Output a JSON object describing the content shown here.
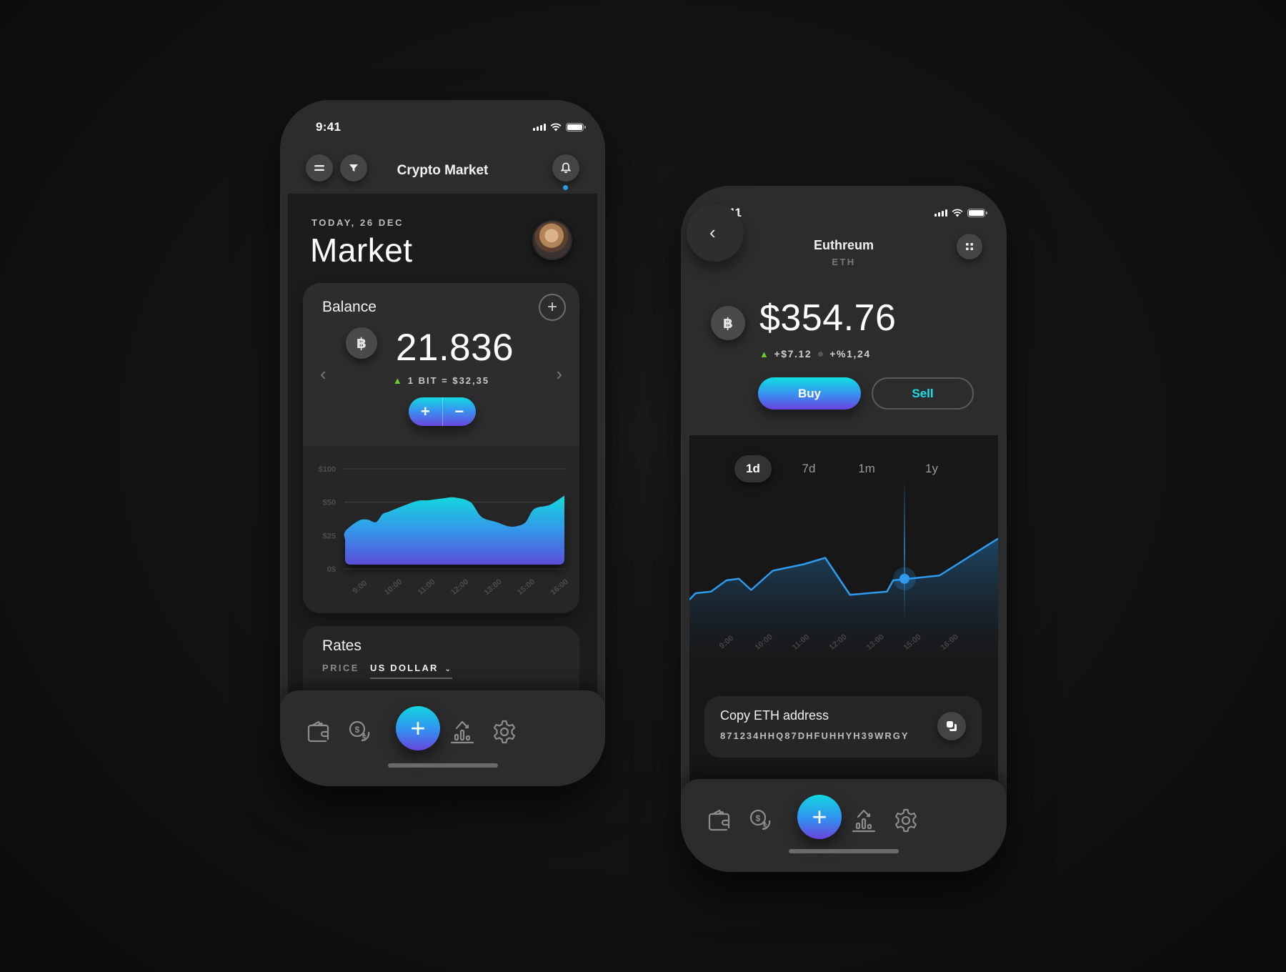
{
  "left_phone": {
    "status": {
      "time": "9:41"
    },
    "header": {
      "title": "Crypto Market",
      "menu_icon": "menu-icon",
      "filter_icon": "filter-icon",
      "notification_icon": "bell-icon",
      "notification_dot": true
    },
    "date_label": "TODAY, 26 DEC",
    "page_title": "Market",
    "balance": {
      "title": "Balance",
      "add_icon": "plus-circle-icon",
      "coin_icon": "bitcoin-icon",
      "coin_glyph": "฿",
      "amount": "21.836",
      "rate": "1 BIT = $32,35",
      "trend": "up",
      "increment_label": "+",
      "decrement_label": "−",
      "prev_arrow": "‹",
      "next_arrow": "›"
    },
    "rates": {
      "title": "Rates",
      "price_label": "PRICE",
      "currency": "US DOLLAR"
    },
    "tabbar": {
      "items": [
        "wallet-icon",
        "coins-icon",
        "add",
        "chart-icon",
        "settings-icon"
      ],
      "fab_label": "+"
    }
  },
  "right_phone": {
    "status": {
      "time": "9:41"
    },
    "header": {
      "back_glyph": "‹",
      "coin_name": "Euthreum",
      "coin_symbol": "ETH",
      "menu_icon": "grid-icon"
    },
    "coin_glyph": "฿",
    "price": "$354.76",
    "change_abs": "+$7.12",
    "change_pct": "+%1,24",
    "trend": "up",
    "buy_label": "Buy",
    "sell_label": "Sell",
    "periods": [
      "1d",
      "7d",
      "1m",
      "1y"
    ],
    "active_period": "1d",
    "copy": {
      "title": "Copy ETH address",
      "address": "871234HHQ87DHFUHHYH39WRGY",
      "icon": "copy-icon"
    },
    "tabbar": {
      "items": [
        "wallet-icon",
        "coins-icon",
        "add",
        "chart-icon",
        "settings-icon"
      ],
      "fab_label": "+"
    }
  },
  "colors": {
    "accent_cyan": "#13d6df",
    "accent_blue": "#338ff0",
    "accent_purple": "#6a44dc",
    "trend_up": "#6ad12b",
    "line_blue": "#2d9cf0"
  },
  "chart_data": [
    {
      "type": "area",
      "title": "Balance",
      "x": [
        "9:00",
        "10:00",
        "11:00",
        "12:00",
        "13:00",
        "15:00",
        "16:00"
      ],
      "x_samples": [
        0,
        0.06,
        0.1,
        0.14,
        0.17,
        0.2,
        0.26,
        0.33,
        0.38,
        0.45,
        0.5,
        0.57,
        0.62,
        0.69,
        0.74,
        0.78,
        0.82,
        0.86,
        0.93,
        1.0
      ],
      "y_samples": [
        22,
        28,
        36,
        37,
        35,
        41,
        43,
        47,
        52,
        53,
        56,
        57,
        50,
        39,
        35,
        32,
        32,
        35,
        45,
        48,
        60
      ],
      "yticks": [
        "0$",
        "$25",
        "$50",
        "$100"
      ],
      "ytick_values": [
        0,
        25,
        50,
        100
      ],
      "ylim": [
        0,
        100
      ],
      "grid": true,
      "note": "y axis is nonlinear in display: ticks 0, 25, 50, 100 equally spaced"
    },
    {
      "type": "line",
      "title": "ETH 1d",
      "x": [
        "9:00",
        "10:00",
        "11:00",
        "12:00",
        "13:00",
        "15:00",
        "16:00"
      ],
      "points": [
        [
          0.0,
          40
        ],
        [
          0.02,
          44
        ],
        [
          0.07,
          45
        ],
        [
          0.12,
          52
        ],
        [
          0.16,
          53
        ],
        [
          0.2,
          46
        ],
        [
          0.27,
          58
        ],
        [
          0.37,
          62
        ],
        [
          0.44,
          66
        ],
        [
          0.52,
          43
        ],
        [
          0.64,
          45
        ],
        [
          0.66,
          52
        ],
        [
          0.71,
          53
        ],
        [
          0.81,
          55
        ],
        [
          1.0,
          78
        ]
      ],
      "highlight_index": 12,
      "ylim": [
        0,
        100
      ],
      "grid": false
    }
  ]
}
